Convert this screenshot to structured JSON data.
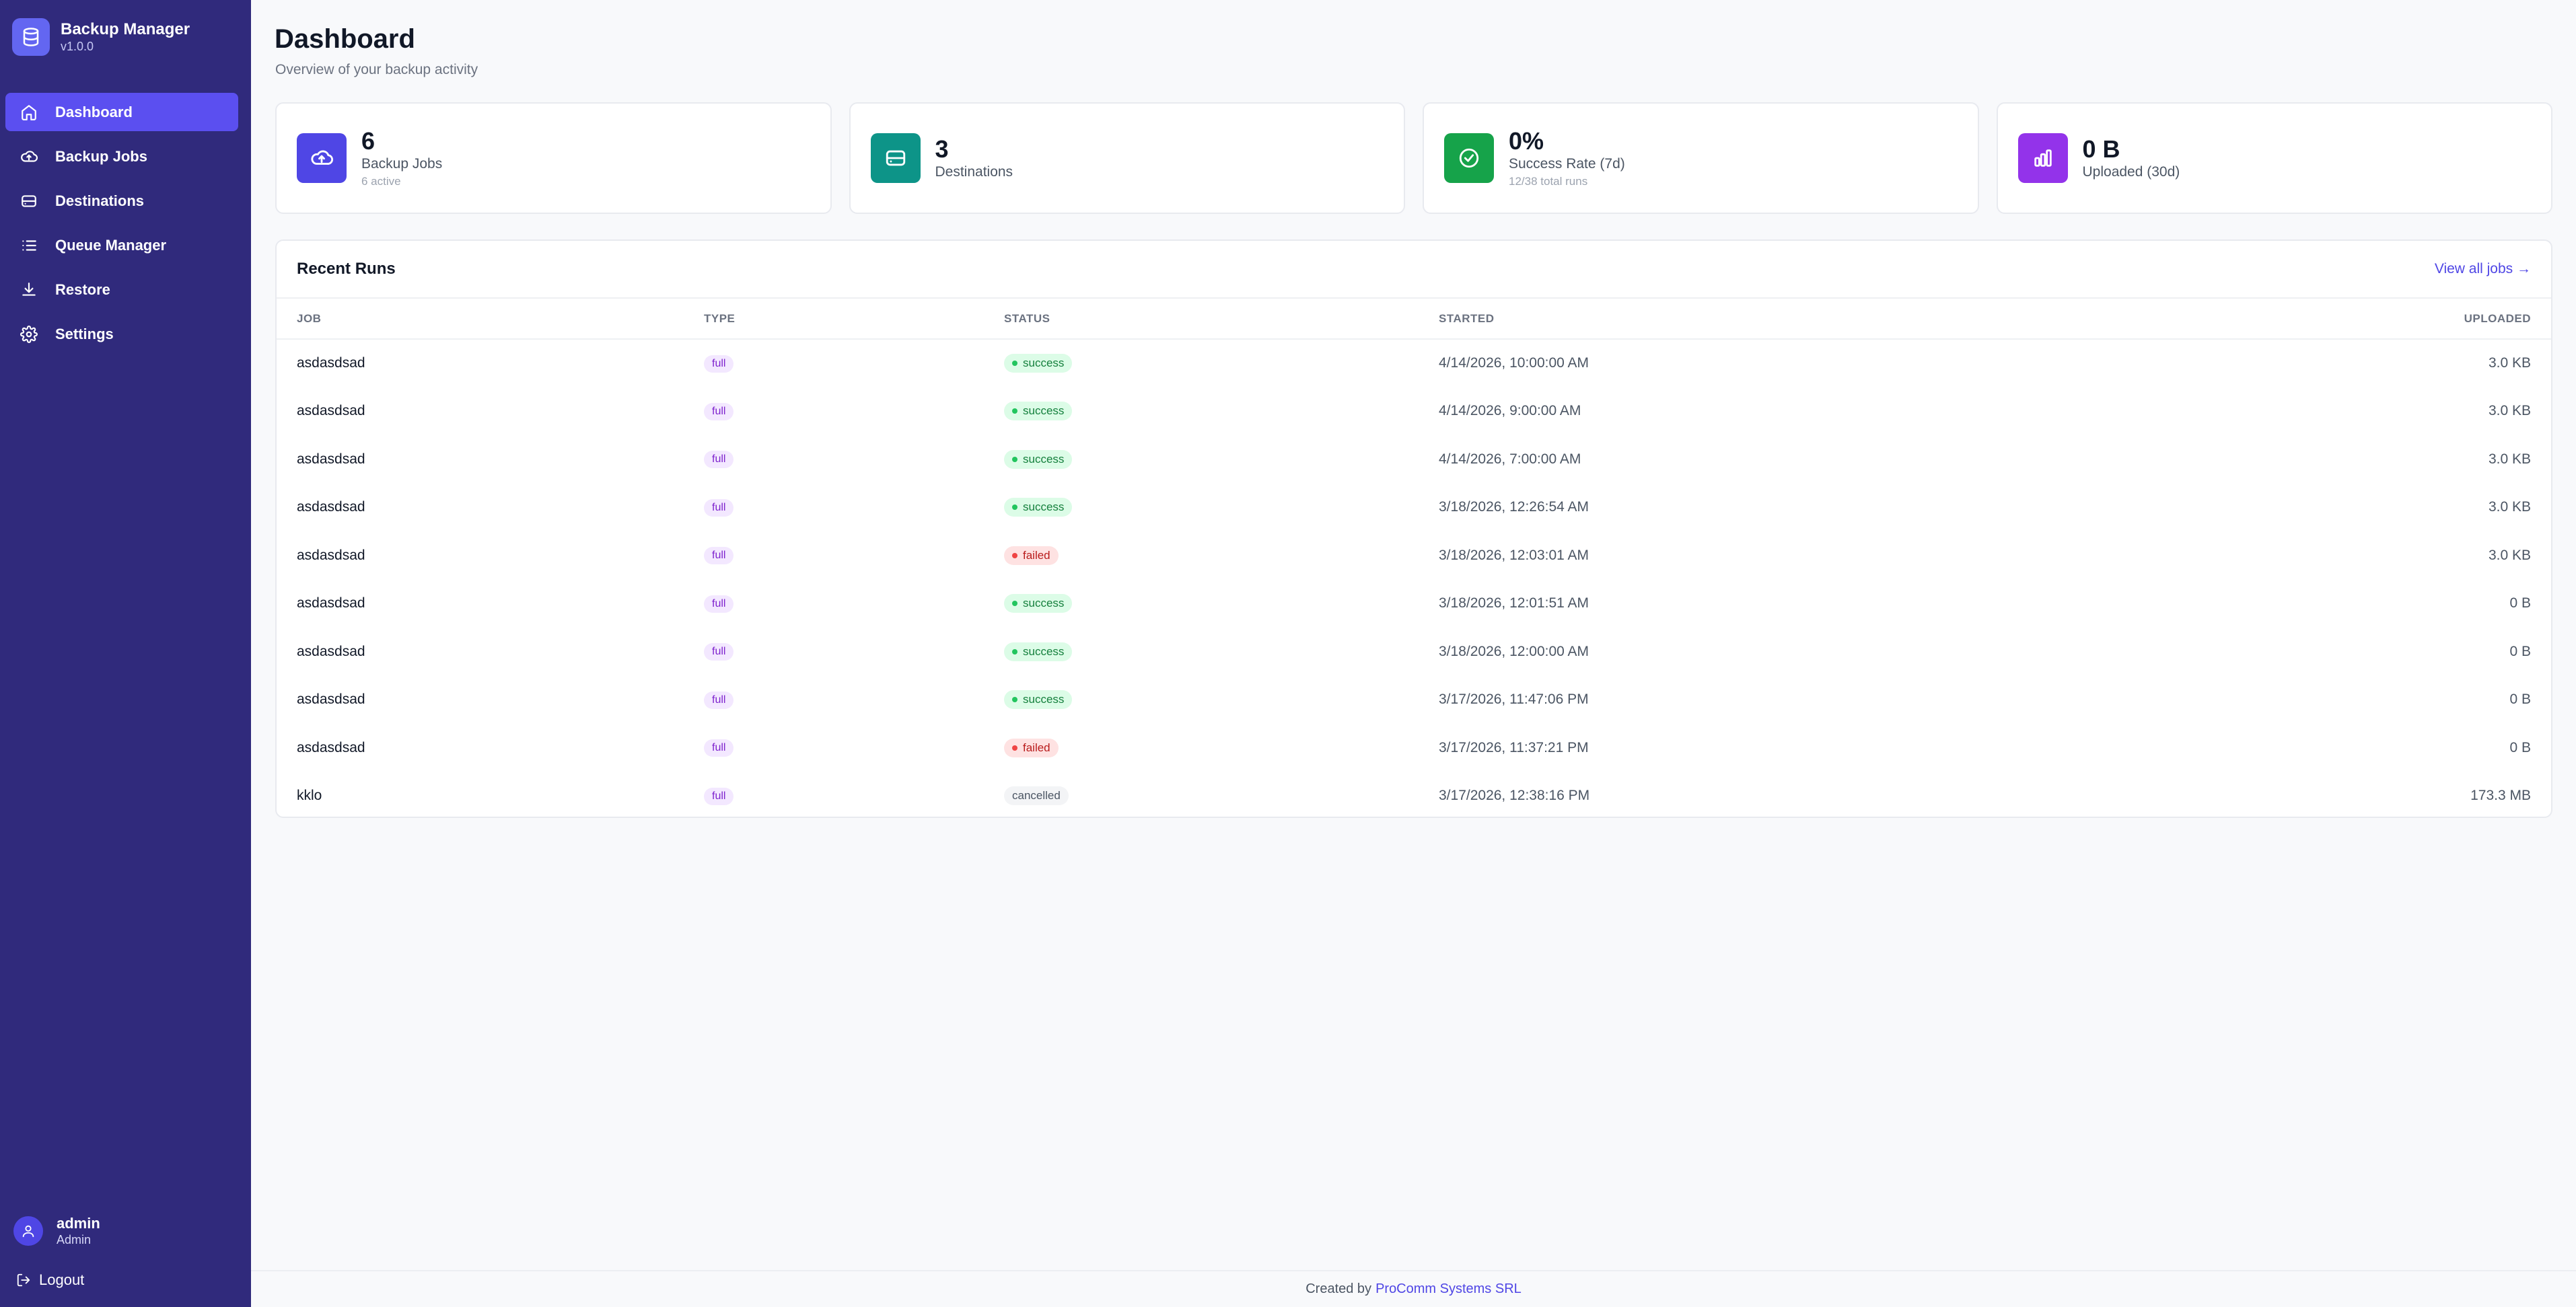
{
  "brand": {
    "name": "Backup Manager",
    "version": "v1.0.0"
  },
  "sidebar": {
    "items": [
      {
        "label": "Dashboard",
        "icon": "home-icon",
        "active": true
      },
      {
        "label": "Backup Jobs",
        "icon": "cloud-upload-icon",
        "active": false
      },
      {
        "label": "Destinations",
        "icon": "storage-icon",
        "active": false
      },
      {
        "label": "Queue Manager",
        "icon": "list-icon",
        "active": false
      },
      {
        "label": "Restore",
        "icon": "download-icon",
        "active": false
      },
      {
        "label": "Settings",
        "icon": "gear-icon",
        "active": false
      }
    ]
  },
  "user": {
    "name": "admin",
    "role": "Admin",
    "logout_label": "Logout"
  },
  "page": {
    "title": "Dashboard",
    "subtitle": "Overview of your backup activity"
  },
  "stats": [
    {
      "value": "6",
      "label": "Backup Jobs",
      "sub": "6 active",
      "icon": "cloud-upload-icon",
      "color": "#4f46e5"
    },
    {
      "value": "3",
      "label": "Destinations",
      "sub": "",
      "icon": "storage-icon",
      "color": "#0d9488"
    },
    {
      "value": "0%",
      "label": "Success Rate (7d)",
      "sub": "12/38 total runs",
      "icon": "check-circle-icon",
      "color": "#16a34a"
    },
    {
      "value": "0 B",
      "label": "Uploaded (30d)",
      "sub": "",
      "icon": "bar-chart-icon",
      "color": "#9333ea"
    }
  ],
  "recent_runs": {
    "title": "Recent Runs",
    "view_all": "View all jobs →",
    "columns": [
      "JOB",
      "TYPE",
      "STATUS",
      "STARTED",
      "UPLOADED"
    ],
    "rows": [
      {
        "job": "asdasdsad",
        "type": "full",
        "status": "success",
        "started": "4/14/2026, 10:00:00 AM",
        "uploaded": "3.0 KB"
      },
      {
        "job": "asdasdsad",
        "type": "full",
        "status": "success",
        "started": "4/14/2026, 9:00:00 AM",
        "uploaded": "3.0 KB"
      },
      {
        "job": "asdasdsad",
        "type": "full",
        "status": "success",
        "started": "4/14/2026, 7:00:00 AM",
        "uploaded": "3.0 KB"
      },
      {
        "job": "asdasdsad",
        "type": "full",
        "status": "success",
        "started": "3/18/2026, 12:26:54 AM",
        "uploaded": "3.0 KB"
      },
      {
        "job": "asdasdsad",
        "type": "full",
        "status": "failed",
        "started": "3/18/2026, 12:03:01 AM",
        "uploaded": "3.0 KB"
      },
      {
        "job": "asdasdsad",
        "type": "full",
        "status": "success",
        "started": "3/18/2026, 12:01:51 AM",
        "uploaded": "0 B"
      },
      {
        "job": "asdasdsad",
        "type": "full",
        "status": "success",
        "started": "3/18/2026, 12:00:00 AM",
        "uploaded": "0 B"
      },
      {
        "job": "asdasdsad",
        "type": "full",
        "status": "success",
        "started": "3/17/2026, 11:47:06 PM",
        "uploaded": "0 B"
      },
      {
        "job": "asdasdsad",
        "type": "full",
        "status": "failed",
        "started": "3/17/2026, 11:37:21 PM",
        "uploaded": "0 B"
      },
      {
        "job": "kklo",
        "type": "full",
        "status": "cancelled",
        "started": "3/17/2026, 12:38:16 PM",
        "uploaded": "173.3 MB"
      }
    ]
  },
  "footer": {
    "prefix": "Created by",
    "link": "ProComm Systems SRL"
  }
}
